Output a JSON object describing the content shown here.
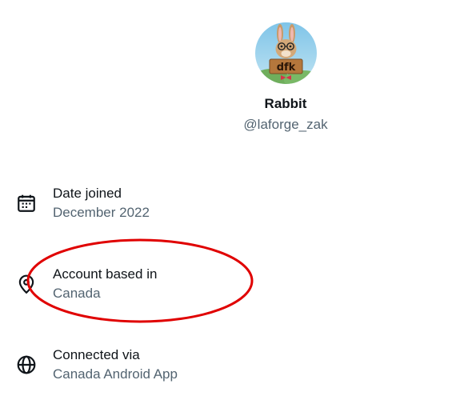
{
  "profile": {
    "display_name": "Rabbit",
    "handle": "@laforge_zak",
    "avatar_sign_text": "dfk"
  },
  "details": [
    {
      "label": "Date joined",
      "value": "December 2022",
      "icon": "calendar-icon"
    },
    {
      "label": "Account based in",
      "value": "Canada",
      "icon": "location-pin-icon"
    },
    {
      "label": "Connected via",
      "value": "Canada Android App",
      "icon": "globe-icon"
    }
  ],
  "colors": {
    "primary_text": "#0f1419",
    "secondary_text": "#536471",
    "annotation": "#e00000"
  }
}
